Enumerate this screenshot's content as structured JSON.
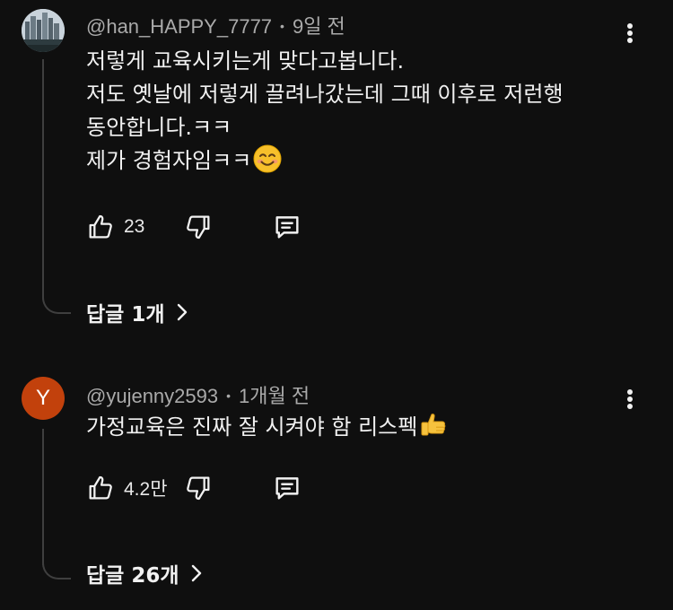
{
  "comments": [
    {
      "author": "@han_HAPPY_7777",
      "time": "9일 전",
      "avatar": {
        "type": "photo",
        "icon": "city-skyline-avatar"
      },
      "lines": [
        "저렇게 교육시키는게 맞다고봅니다.",
        "저도 옛날에 저렇게 끌려나갔는데 그때 이후로 저런행",
        "동안합니다.ㅋㅋ",
        "제가 경험자임ㅋㅋ"
      ],
      "likes": "23",
      "replies_label": "답글 1개"
    },
    {
      "author": "@yujenny2593",
      "time": "1개월 전",
      "avatar": {
        "type": "letter",
        "letter": "Y",
        "color": "#c2410c"
      },
      "lines": [
        "가정교육은 진짜 잘 시켜야 함 리스펙"
      ],
      "likes": "4.2만",
      "replies_label": "답글 26개"
    }
  ],
  "icons": {
    "like": "thumbs-up-icon",
    "dislike": "thumbs-down-icon",
    "reply": "reply-comment-icon",
    "more": "more-vertical-icon",
    "chevron": "chevron-right-icon",
    "emoji_smile": "smiling-face-emoji",
    "emoji_thumbs": "thumbs-up-emoji"
  },
  "colors": {
    "background": "#0f0f0f",
    "text": "#f1f1f1",
    "meta": "#aaaaaa",
    "thread": "#3f3f3f"
  }
}
